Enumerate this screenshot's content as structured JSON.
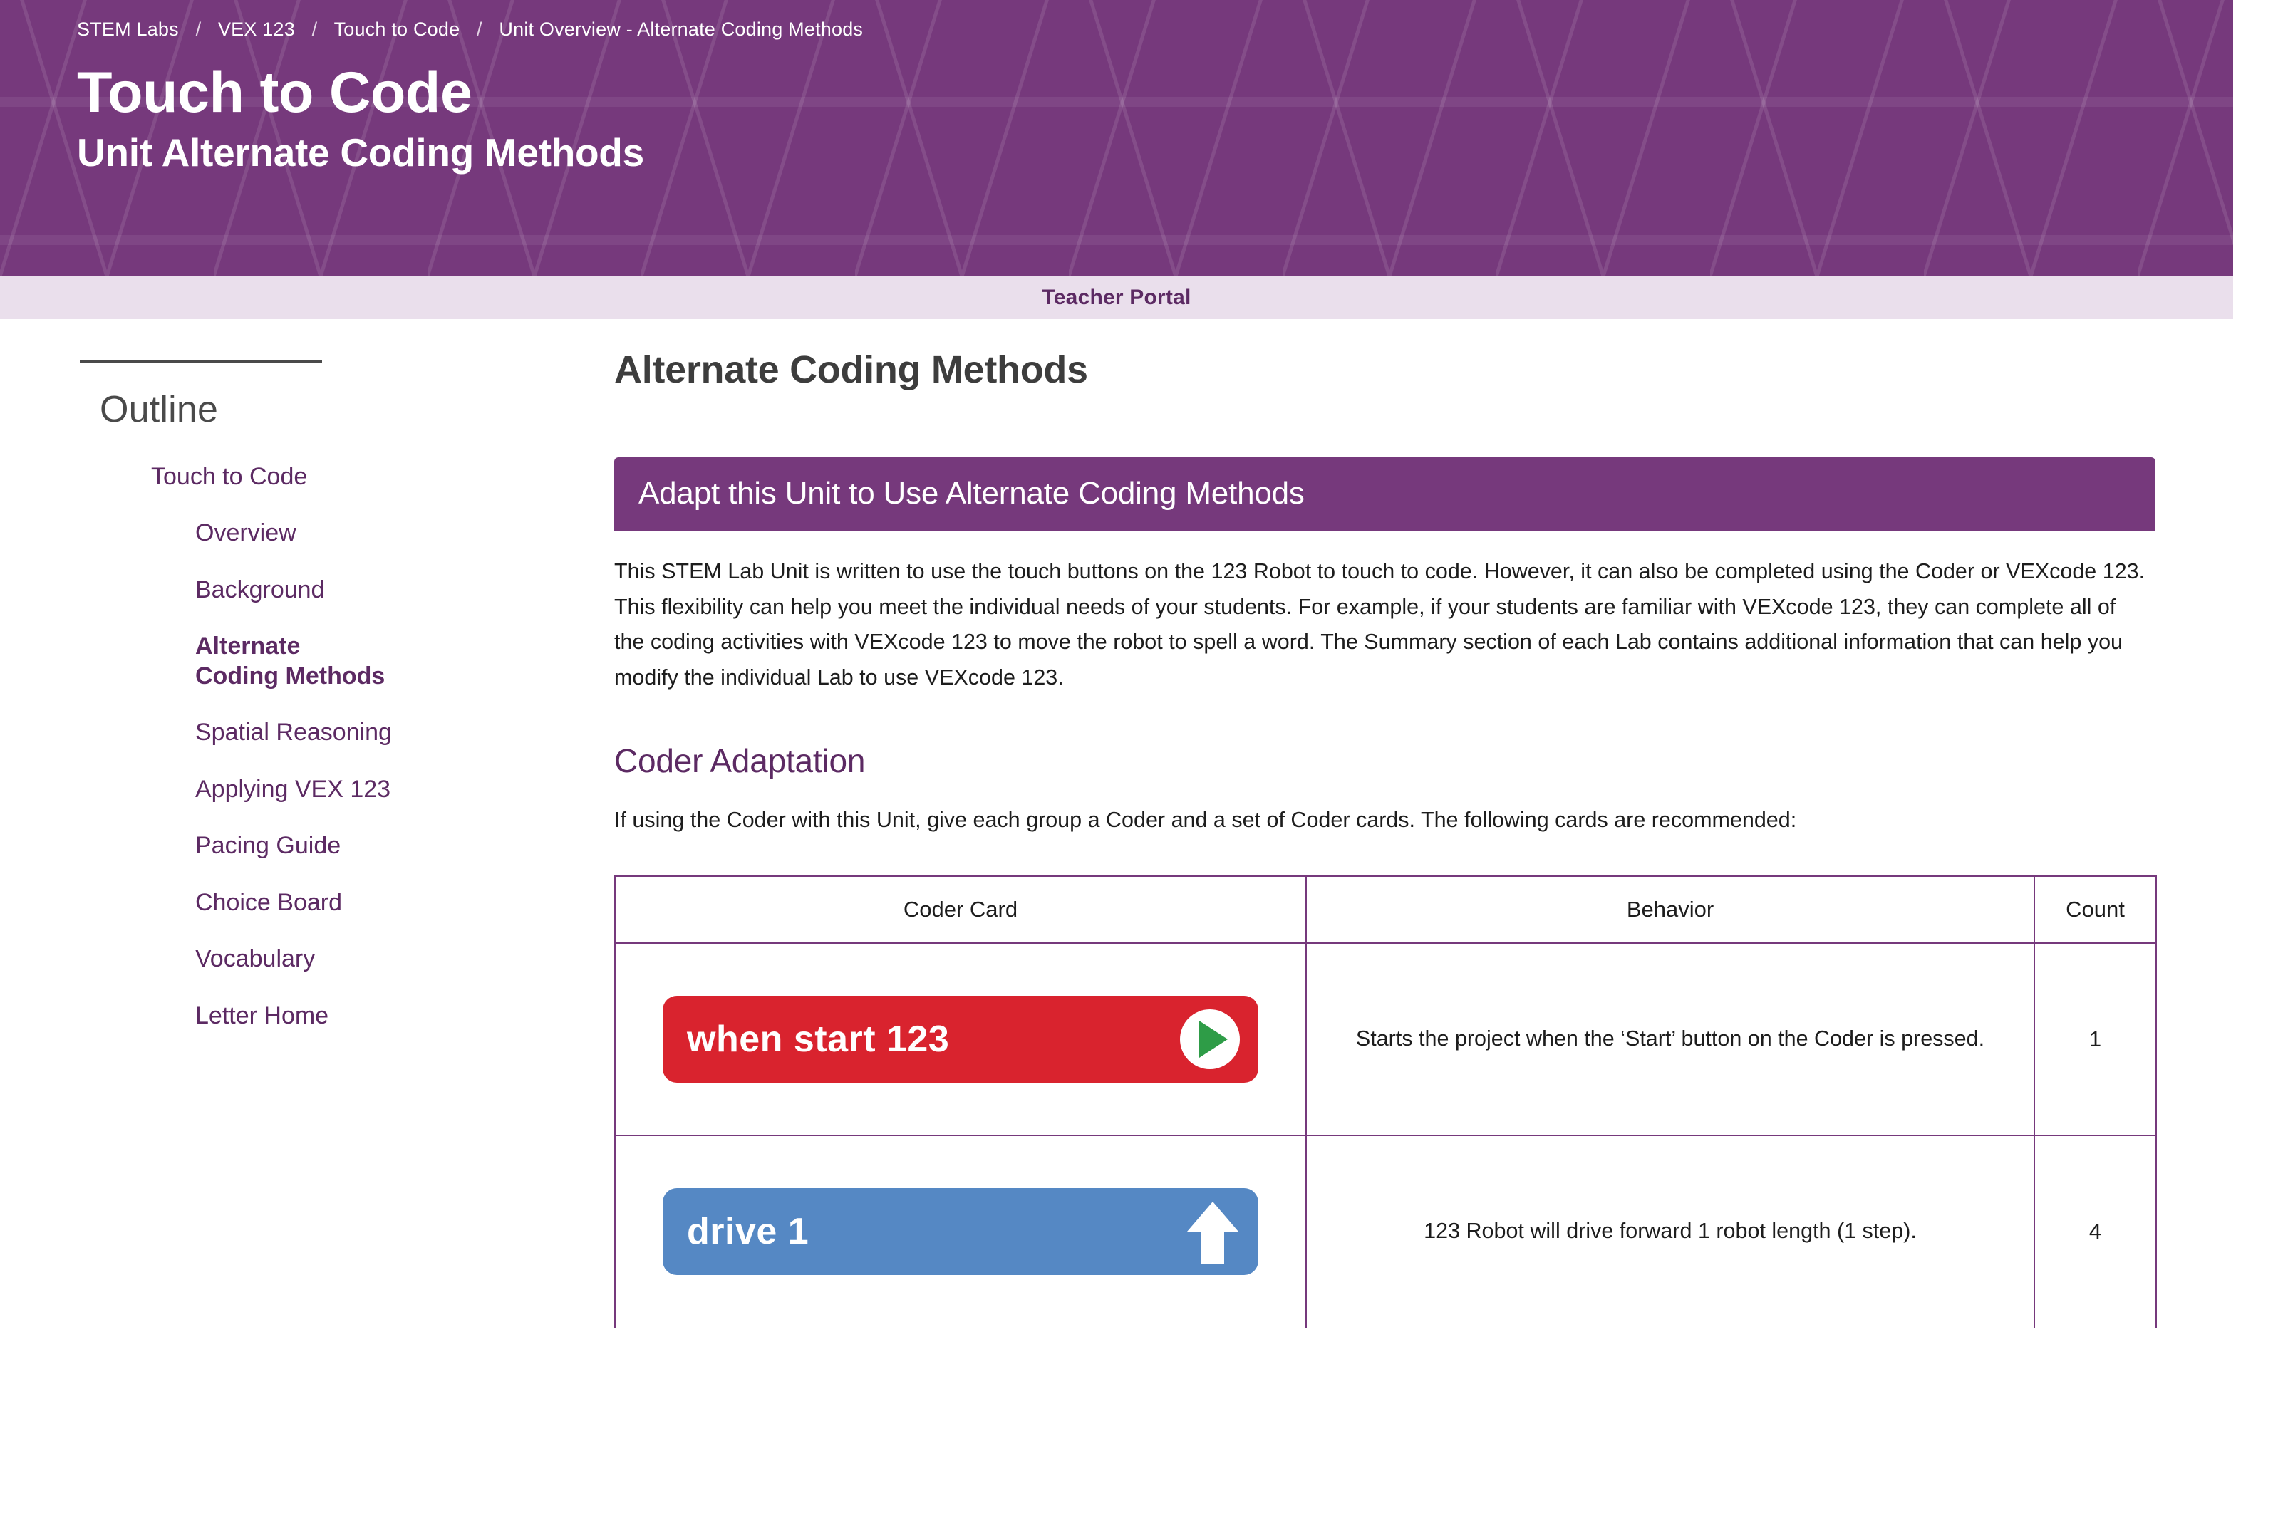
{
  "header": {
    "breadcrumb": [
      {
        "label": "STEM Labs"
      },
      {
        "label": "VEX 123"
      },
      {
        "label": "Touch to Code"
      },
      {
        "label": "Unit Overview - Alternate Coding Methods"
      }
    ],
    "separator": "/",
    "title": "Touch to Code",
    "subtitle": "Unit Alternate Coding Methods",
    "background_color": "#76397c"
  },
  "portal_bar": {
    "label": "Teacher Portal",
    "background_color": "#eadfec",
    "text_color": "#5c2a63"
  },
  "sidebar": {
    "heading": "Outline",
    "items": [
      {
        "label": "Touch to Code",
        "level": 1,
        "active": false
      },
      {
        "label": "Overview",
        "level": 2,
        "active": false
      },
      {
        "label": "Background",
        "level": 2,
        "active": false
      },
      {
        "label": "Alternate Coding Methods",
        "level": 2,
        "active": true
      },
      {
        "label": "Spatial Reasoning",
        "level": 2,
        "active": false
      },
      {
        "label": "Applying VEX 123",
        "level": 2,
        "active": false
      },
      {
        "label": "Pacing Guide",
        "level": 2,
        "active": false
      },
      {
        "label": "Choice Board",
        "level": 2,
        "active": false
      },
      {
        "label": "Vocabulary",
        "level": 2,
        "active": false
      },
      {
        "label": "Letter Home",
        "level": 2,
        "active": false
      }
    ]
  },
  "main": {
    "page_title": "Alternate Coding Methods",
    "callout": {
      "title": "Adapt this Unit to Use Alternate Coding Methods",
      "background_color": "#76397c"
    },
    "intro_paragraph": "This STEM Lab Unit is written to use the touch buttons on the 123 Robot to touch to code. However, it can also be completed using the Coder or VEXcode 123. This flexibility can help you meet the individual needs of your students. For example, if your students are familiar with VEXcode 123, they can complete all of the coding activities with VEXcode 123 to move the robot to spell a word. The Summary section of each Lab contains additional information that can help you modify the individual Lab to use VEXcode 123.",
    "section_heading": "Coder Adaptation",
    "section_paragraph": "If using the Coder with this Unit, give each group a Coder and a set of Coder cards. The following cards are recommended:",
    "table": {
      "columns": [
        "Coder Card",
        "Behavior",
        "Count"
      ],
      "rows": [
        {
          "card": {
            "label": "when start 123",
            "color": "#d9232e",
            "icon": "play-circle-icon"
          },
          "behavior": "Starts the project when the ‘Start’ button on the Coder is pressed.",
          "count": "1"
        },
        {
          "card": {
            "label": "drive 1",
            "color": "#5588c4",
            "icon": "arrow-up-icon"
          },
          "behavior": "123 Robot will drive forward 1 robot length (1 step).",
          "count": "4"
        }
      ]
    }
  }
}
